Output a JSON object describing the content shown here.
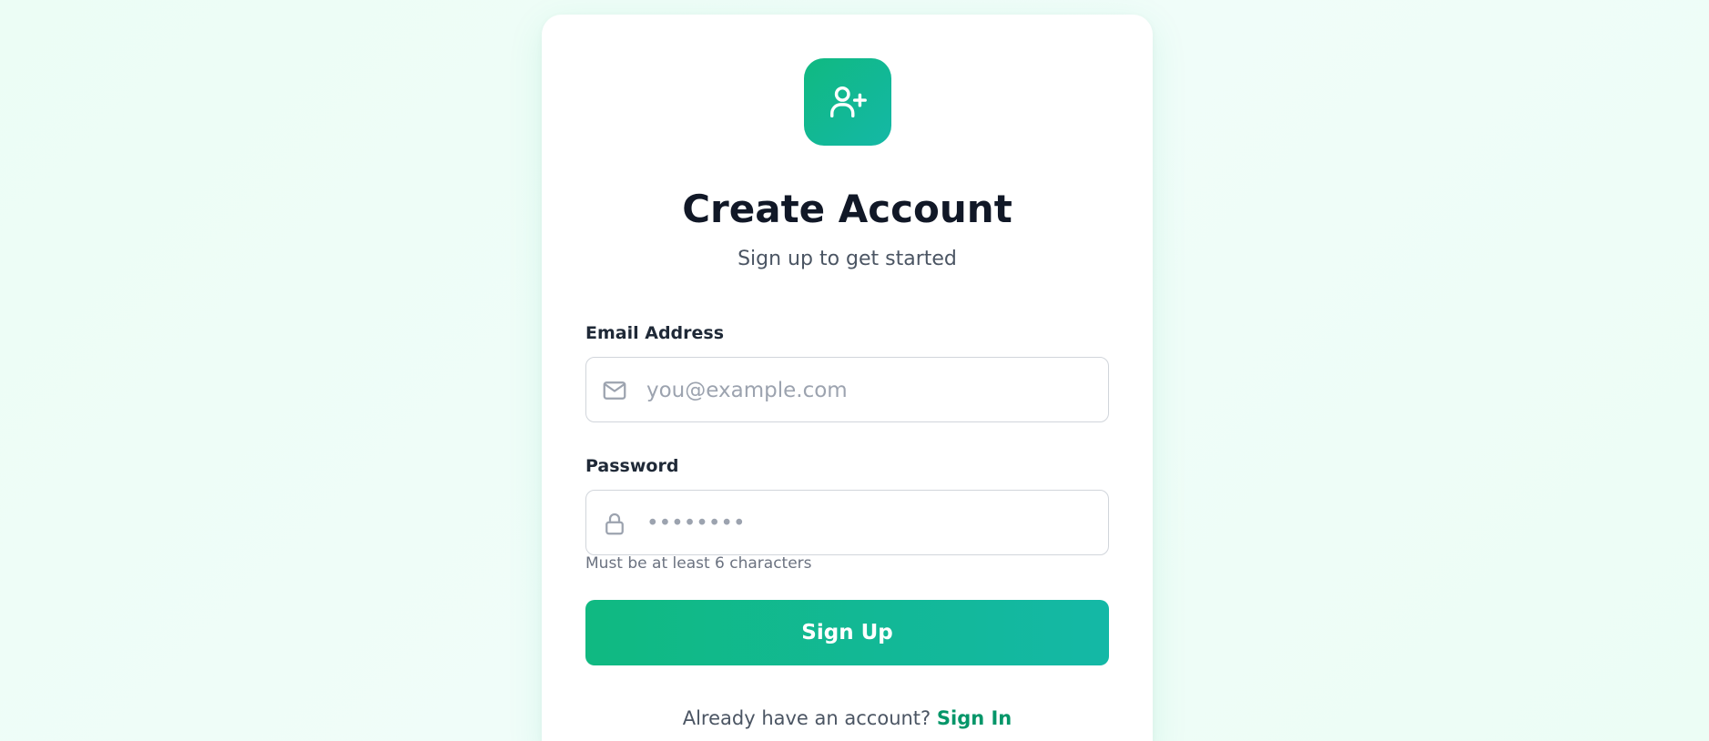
{
  "header": {
    "logo_icon": "user-plus-icon",
    "title": "Create Account",
    "subtitle": "Sign up to get started"
  },
  "form": {
    "email": {
      "label": "Email Address",
      "icon": "mail-icon",
      "placeholder": "you@example.com",
      "value": ""
    },
    "password": {
      "label": "Password",
      "icon": "lock-icon",
      "placeholder": "••••••••",
      "value": "",
      "hint": "Must be at least 6 characters"
    },
    "submit_label": "Sign Up"
  },
  "footer": {
    "prompt": "Already have an account?",
    "link_label": "Sign In"
  },
  "colors": {
    "accent": "#10b981",
    "accent_end": "#14b8a6",
    "link": "#059669",
    "title": "#111827"
  }
}
